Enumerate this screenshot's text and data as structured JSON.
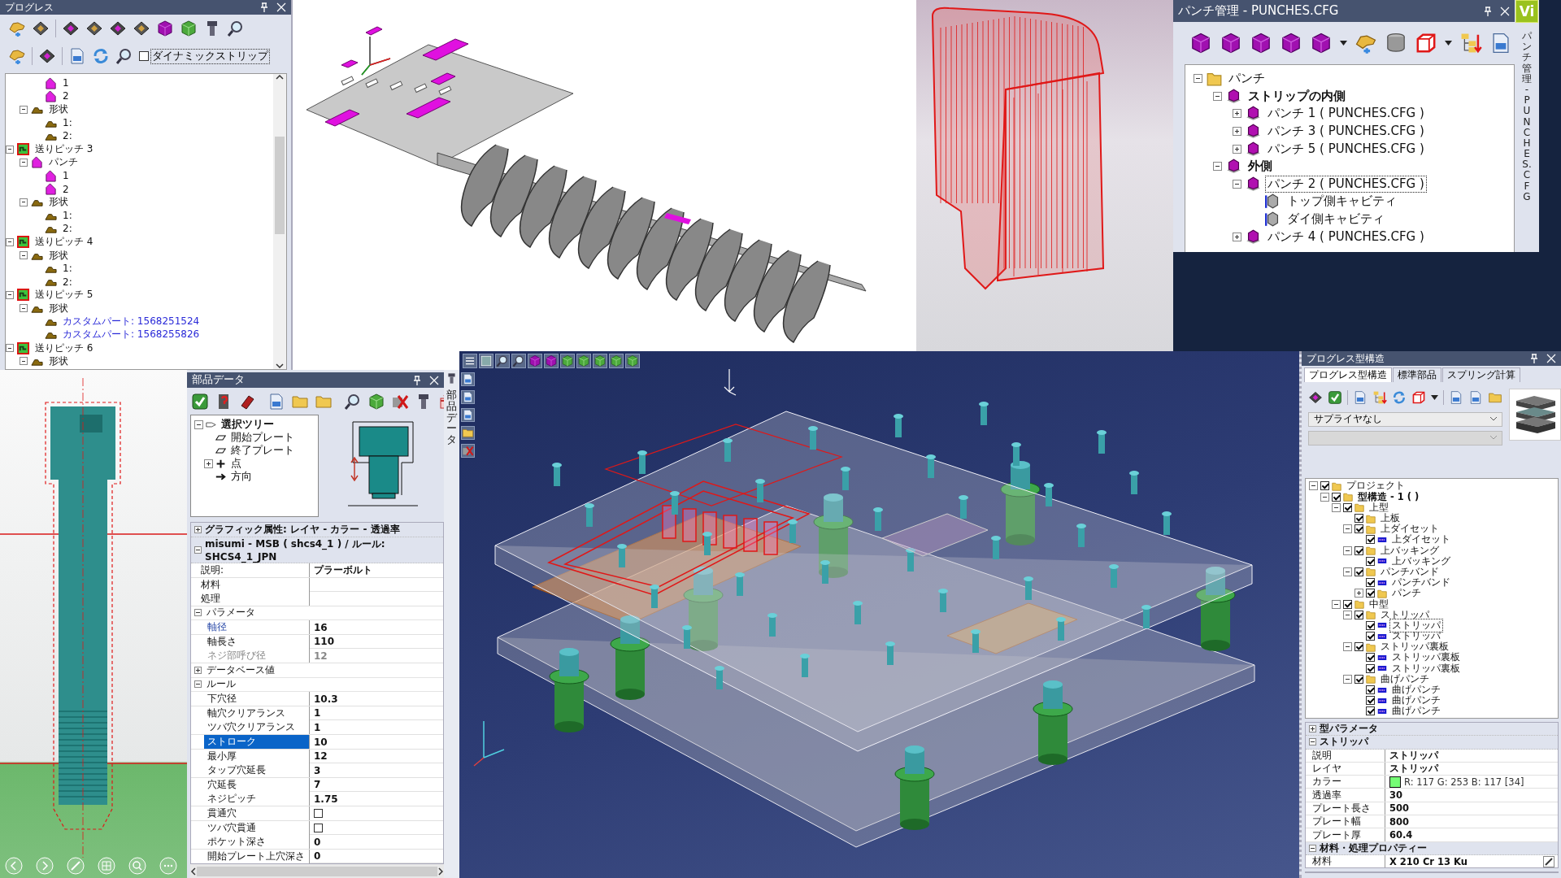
{
  "progress_panel": {
    "title": "プログレス",
    "dynamic_strip": {
      "label": "ダイナミックストリップ",
      "checked": false
    },
    "tree": [
      {
        "children": [
          {
            "children": [
              {
                "label": "1",
                "kind": "punch"
              },
              {
                "label": "2",
                "kind": "punch"
              }
            ]
          },
          {
            "label": "形状",
            "kind": "shape",
            "expanded": true,
            "children": [
              {
                "label": "1:",
                "kind": "shape"
              },
              {
                "label": "2:",
                "kind": "shape"
              }
            ]
          }
        ]
      },
      {
        "label": "送りピッチ 3",
        "kind": "pitch",
        "expanded": true,
        "children": [
          {
            "label": "パンチ",
            "kind": "punch",
            "expanded": true,
            "children": [
              {
                "label": "1",
                "kind": "punch"
              },
              {
                "label": "2",
                "kind": "punch"
              }
            ]
          },
          {
            "label": "形状",
            "kind": "shape",
            "expanded": true,
            "children": [
              {
                "label": "1:",
                "kind": "shape"
              },
              {
                "label": "2:",
                "kind": "shape"
              }
            ]
          }
        ]
      },
      {
        "label": "送りピッチ 4",
        "kind": "pitch",
        "expanded": true,
        "children": [
          {
            "label": "形状",
            "kind": "shape",
            "expanded": true,
            "children": [
              {
                "label": "1:",
                "kind": "shape"
              },
              {
                "label": "2:",
                "kind": "shape"
              }
            ]
          }
        ]
      },
      {
        "label": "送りピッチ 5",
        "kind": "pitch",
        "expanded": true,
        "children": [
          {
            "label": "形状",
            "kind": "shape",
            "expanded": true,
            "children": [
              {
                "label": "カスタムパート: 1568251524",
                "kind": "custom"
              },
              {
                "label": "カスタムパート: 1568255826",
                "kind": "custom"
              }
            ]
          }
        ]
      },
      {
        "label": "送りピッチ 6",
        "kind": "pitch",
        "expanded": true,
        "children": [
          {
            "label": "形状",
            "kind": "shape",
            "expanded": true
          }
        ]
      }
    ]
  },
  "punch_panel": {
    "title": "パンチ管理 - PUNCHES.CFG",
    "side_tab": "パンチ管理 - PUNCHES.CFG",
    "badge": "Vi",
    "tree": [
      {
        "label": "パンチ",
        "kind": "folder",
        "expanded": true,
        "selected": false,
        "children": [
          {
            "label": "ストリップの内側",
            "kind": "group",
            "expanded": true,
            "selected": false,
            "children": [
              {
                "label": "パンチ 1 ( PUNCHES.CFG )",
                "kind": "punch3d",
                "expanded": false,
                "selected": false
              },
              {
                "label": "パンチ 3 ( PUNCHES.CFG )",
                "kind": "punch3d",
                "expanded": false,
                "selected": false
              },
              {
                "label": "パンチ 5 ( PUNCHES.CFG )",
                "kind": "punch3d",
                "expanded": false,
                "selected": false
              }
            ]
          },
          {
            "label": "外側",
            "kind": "group",
            "expanded": true,
            "selected": false,
            "children": [
              {
                "label": "パンチ 2 ( PUNCHES.CFG )",
                "kind": "punch3d",
                "expanded": true,
                "selected": true,
                "children": [
                  {
                    "label": "トップ側キャビティ",
                    "kind": "cavity",
                    "selected": false
                  },
                  {
                    "label": "ダイ側キャビティ",
                    "kind": "cavity",
                    "selected": false
                  }
                ]
              },
              {
                "label": "パンチ 4 ( PUNCHES.CFG )",
                "kind": "punch3d",
                "expanded": false,
                "selected": false
              }
            ]
          }
        ]
      }
    ]
  },
  "parts_panel": {
    "title": "部品データ",
    "side_tab": "部品データ",
    "selection_tree": [
      {
        "label": "選択ツリー",
        "kind": "root",
        "expanded": true,
        "children": [
          {
            "label": "開始プレート",
            "kind": "plate"
          },
          {
            "label": "終了プレート",
            "kind": "plate"
          },
          {
            "label": "点",
            "kind": "point",
            "expanded": false
          },
          {
            "label": "方向",
            "kind": "direction"
          }
        ]
      }
    ],
    "property_grid": [
      {
        "title": "グラフィック属性: レイヤ - カラー - 透過率",
        "expanded": false
      },
      {
        "title": "misumi - MSB ( shcs4_1 ) / ルール: SHCS4_1_JPN",
        "expanded": true,
        "rows": [
          {
            "kind": "text",
            "label": "説明:",
            "value": "プラーボルト",
            "selected": false,
            "disabled": false,
            "modified": false
          },
          {
            "kind": "text",
            "label": "材料",
            "selected": false,
            "disabled": false,
            "modified": false
          },
          {
            "kind": "text",
            "label": "処理",
            "selected": false,
            "disabled": false,
            "modified": false
          },
          {
            "kind": "group",
            "label": "パラメータ",
            "expanded": true,
            "rows": [
              {
                "kind": "text",
                "label": "軸径",
                "value": "16",
                "selected": false,
                "disabled": false,
                "modified": true
              },
              {
                "kind": "text",
                "label": "軸長さ",
                "value": "110",
                "selected": false,
                "disabled": false,
                "modified": false
              },
              {
                "kind": "text",
                "label": "ネジ部呼び径",
                "value": "12",
                "selected": false,
                "disabled": true,
                "modified": false
              }
            ]
          },
          {
            "kind": "group",
            "label": "データベース値",
            "expanded": false
          },
          {
            "kind": "group",
            "label": "ルール",
            "expanded": true,
            "rows": [
              {
                "kind": "text",
                "label": "下穴径",
                "value": "10.3",
                "selected": false,
                "disabled": false,
                "modified": false
              },
              {
                "kind": "text",
                "label": "軸穴クリアランス",
                "value": "1",
                "selected": false,
                "disabled": false,
                "modified": false
              },
              {
                "kind": "text",
                "label": "ツバ穴クリアランス",
                "value": "1",
                "selected": false,
                "disabled": false,
                "modified": false
              },
              {
                "kind": "text",
                "label": "ストローク",
                "value": "10",
                "selected": true,
                "disabled": false,
                "modified": false
              },
              {
                "kind": "text",
                "label": "最小厚",
                "value": "12",
                "selected": false,
                "disabled": false,
                "modified": false
              },
              {
                "kind": "text",
                "label": "タップ穴延長",
                "value": "3",
                "selected": false,
                "disabled": false,
                "modified": false
              },
              {
                "kind": "text",
                "label": "穴延長",
                "value": "7",
                "selected": false,
                "disabled": false,
                "modified": false
              },
              {
                "kind": "text",
                "label": "ネジピッチ",
                "value": "1.75",
                "selected": false,
                "disabled": false,
                "modified": false
              },
              {
                "kind": "check",
                "label": "貫通穴",
                "checked": false,
                "selected": false,
                "disabled": false,
                "modified": false
              },
              {
                "kind": "check",
                "label": "ツバ穴貫通",
                "checked": false,
                "selected": false,
                "disabled": false,
                "modified": false
              },
              {
                "kind": "text",
                "label": "ポケット深さ",
                "value": "0",
                "selected": false,
                "disabled": false,
                "modified": false
              },
              {
                "kind": "text",
                "label": "開始プレート上穴深さ",
                "value": "0",
                "selected": false,
                "disabled": false,
                "modified": false
              }
            ]
          }
        ]
      }
    ]
  },
  "structure_panel": {
    "title": "プログレス型構造",
    "tabs": [
      {
        "label": "プログレス型構造",
        "selected": true
      },
      {
        "label": "標準部品",
        "selected": false
      },
      {
        "label": "スプリング計算",
        "selected": false
      }
    ],
    "supplier": {
      "value": "サプライヤなし"
    },
    "tree": [
      {
        "label": "プロジェクト",
        "kind": "folder",
        "checked": true,
        "expanded": true,
        "selected": false,
        "children": [
          {
            "label": "型構造 - 1 ( )",
            "kind": "assembly",
            "checked": true,
            "expanded": true,
            "selected": false,
            "children": [
              {
                "label": "上型",
                "kind": "folder",
                "checked": true,
                "expanded": true,
                "selected": false,
                "children": [
                  {
                    "label": "上板",
                    "kind": "folder",
                    "checked": true,
                    "selected": false
                  },
                  {
                    "label": "上ダイセット",
                    "kind": "folder",
                    "checked": true,
                    "expanded": true,
                    "selected": false,
                    "children": [
                      {
                        "label": "上ダイセット",
                        "kind": "plate",
                        "checked": true,
                        "selected": false
                      }
                    ]
                  },
                  {
                    "label": "上バッキング",
                    "kind": "folder",
                    "checked": true,
                    "expanded": true,
                    "selected": false,
                    "children": [
                      {
                        "label": "上バッキング",
                        "kind": "plate",
                        "checked": true,
                        "selected": false
                      }
                    ]
                  },
                  {
                    "label": "パンチバンド",
                    "kind": "folder",
                    "checked": true,
                    "expanded": true,
                    "selected": false,
                    "children": [
                      {
                        "label": "パンチバンド",
                        "kind": "plate",
                        "checked": true,
                        "selected": false
                      },
                      {
                        "label": "パンチ",
                        "kind": "folder",
                        "checked": true,
                        "expanded": false,
                        "selected": false
                      }
                    ]
                  }
                ]
              },
              {
                "label": "中型",
                "kind": "folder",
                "checked": true,
                "expanded": true,
                "selected": false,
                "children": [
                  {
                    "label": "ストリッパ",
                    "kind": "folder",
                    "checked": true,
                    "expanded": true,
                    "selected": false,
                    "children": [
                      {
                        "label": "ストリッパ",
                        "kind": "plate",
                        "checked": true,
                        "selected": true
                      },
                      {
                        "label": "ストリッパ",
                        "kind": "plate",
                        "checked": true,
                        "selected": false
                      }
                    ]
                  },
                  {
                    "label": "ストリッパ裏板",
                    "kind": "folder",
                    "checked": true,
                    "expanded": true,
                    "selected": false,
                    "children": [
                      {
                        "label": "ストリッパ裏板",
                        "kind": "plate",
                        "checked": true,
                        "selected": false
                      },
                      {
                        "label": "ストリッパ裏板",
                        "kind": "plate",
                        "checked": true,
                        "selected": false
                      }
                    ]
                  },
                  {
                    "label": "曲げパンチ",
                    "kind": "folder",
                    "checked": true,
                    "expanded": true,
                    "selected": false,
                    "children": [
                      {
                        "label": "曲げパンチ",
                        "kind": "plate",
                        "checked": true,
                        "selected": false
                      },
                      {
                        "label": "曲げパンチ",
                        "kind": "plate",
                        "checked": true,
                        "selected": false
                      },
                      {
                        "label": "曲げパンチ",
                        "kind": "plate",
                        "checked": true,
                        "selected": false
                      }
                    ]
                  }
                ]
              }
            ]
          }
        ]
      }
    ],
    "property_grid": [
      {
        "title": "型パラメータ",
        "expanded": false
      },
      {
        "title": "ストリッパ",
        "expanded": true,
        "rows": [
          {
            "kind": "text",
            "label": "説明",
            "value": "ストリッパ"
          },
          {
            "kind": "text",
            "label": "レイヤ",
            "value": "ストリッパ"
          },
          {
            "kind": "color",
            "label": "カラー",
            "value": "R: 117 G: 253 B: 117 [34]",
            "color": "#75fd75"
          },
          {
            "kind": "text",
            "label": "透過率",
            "value": "30"
          },
          {
            "kind": "text",
            "label": "プレート長さ",
            "value": "500"
          },
          {
            "kind": "text",
            "label": "プレート幅",
            "value": "800"
          },
          {
            "kind": "text",
            "label": "プレート厚",
            "value": "60.4"
          }
        ]
      },
      {
        "title": "材料・処理プロパティー",
        "expanded": true,
        "rows": [
          {
            "kind": "edit",
            "label": "材料",
            "value": "X 210 Cr 13 Ku"
          }
        ]
      }
    ]
  }
}
